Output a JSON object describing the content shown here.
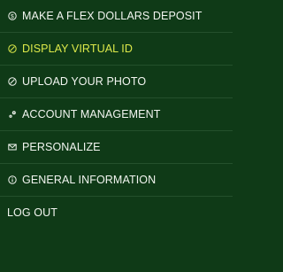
{
  "menu": {
    "items": [
      {
        "label": "MAKE A FLEX DOLLARS DEPOSIT",
        "icon": "dollar-circle-icon"
      },
      {
        "label": "DISPLAY VIRTUAL ID",
        "icon": "no-entry-circle-icon",
        "active": true
      },
      {
        "label": "UPLOAD YOUR PHOTO",
        "icon": "no-entry-circle-icon"
      },
      {
        "label": "ACCOUNT MANAGEMENT",
        "icon": "gears-icon"
      },
      {
        "label": "PERSONALIZE",
        "icon": "envelope-icon"
      },
      {
        "label": "GENERAL INFORMATION",
        "icon": "info-circle-icon"
      },
      {
        "label": "LOG OUT"
      }
    ]
  },
  "colors": {
    "background": "#0f3a17",
    "text": "#f2f5f0",
    "active_text": "#dde94a",
    "divider": "#24502c"
  }
}
